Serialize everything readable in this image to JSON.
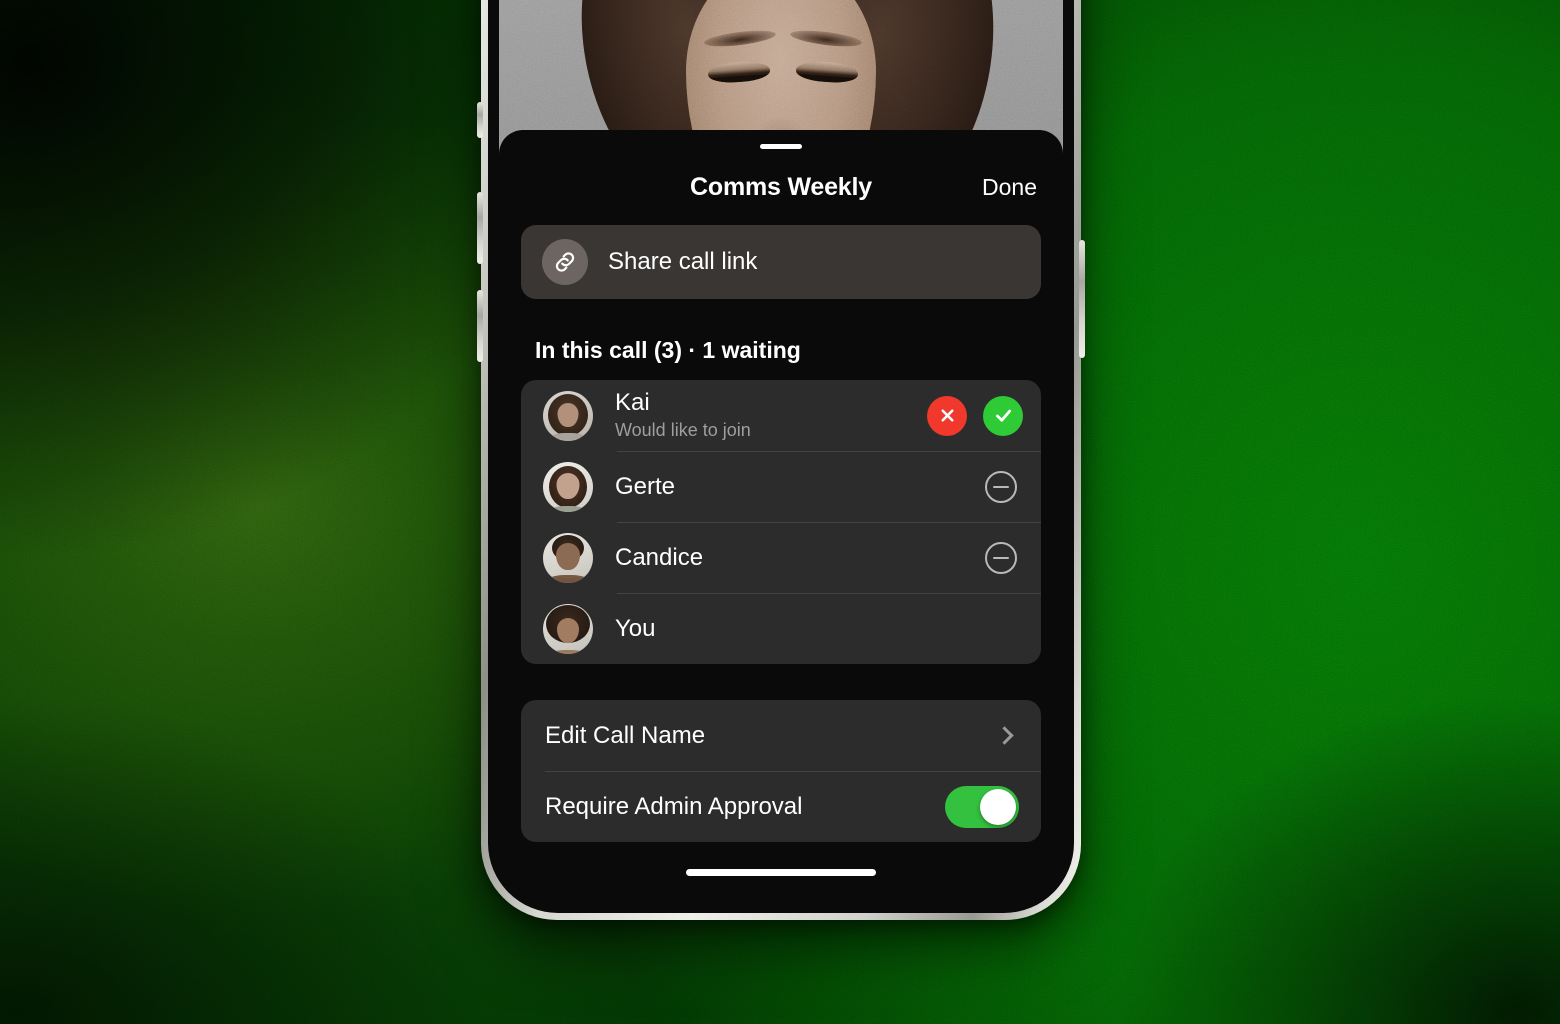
{
  "background": {
    "name": "green-gradient-backdrop",
    "base_color": "#0a7a08",
    "highlight_color": "#63cc1e",
    "shadow_color": "#057005"
  },
  "device": {
    "name": "iphone-frame",
    "frame_color": "#d8d8d2",
    "screen_background": "#000000",
    "buttons": [
      {
        "name": "silent-switch"
      },
      {
        "name": "volume-up-button"
      },
      {
        "name": "volume-down-button"
      },
      {
        "name": "power-button"
      }
    ],
    "home_indicator": "home-indicator"
  },
  "video": {
    "name": "active-speaker-video",
    "background_color": "#969696",
    "description": "smiling person with curly dark hair"
  },
  "sheet": {
    "background_color": "#0a0a0a",
    "grabber": "drag-handle",
    "header": {
      "title": "Comms Weekly",
      "done_label": "Done"
    },
    "share": {
      "label": "Share call link",
      "icon": "link-icon",
      "icon_bg": "#6d6561",
      "card_bg": "#3a3634"
    },
    "section_heading": "In this call (3) · 1 waiting",
    "participants": [
      {
        "name": "Kai",
        "subtitle": "Would like to join",
        "state": "waiting",
        "actions": [
          {
            "name": "decline-button",
            "icon": "x-icon",
            "color": "#f0392c"
          },
          {
            "name": "admit-button",
            "icon": "check-icon",
            "color": "#2ecb36"
          }
        ]
      },
      {
        "name": "Gerte",
        "subtitle": "",
        "state": "in-call",
        "actions": [
          {
            "name": "remove-participant-button",
            "icon": "minus-circle-icon",
            "color": "#b9b9b9"
          }
        ]
      },
      {
        "name": "Candice",
        "subtitle": "",
        "state": "in-call",
        "actions": [
          {
            "name": "remove-participant-button",
            "icon": "minus-circle-icon",
            "color": "#b9b9b9"
          }
        ]
      },
      {
        "name": "You",
        "subtitle": "",
        "state": "self",
        "actions": []
      }
    ],
    "settings": [
      {
        "label": "Edit Call Name",
        "control": "chevron",
        "value": ""
      },
      {
        "label": "Require Admin Approval",
        "control": "toggle",
        "value": "on",
        "toggle_color": "#34c13f"
      }
    ],
    "card_background": "#2c2c2c",
    "separator_color": "#434343"
  }
}
